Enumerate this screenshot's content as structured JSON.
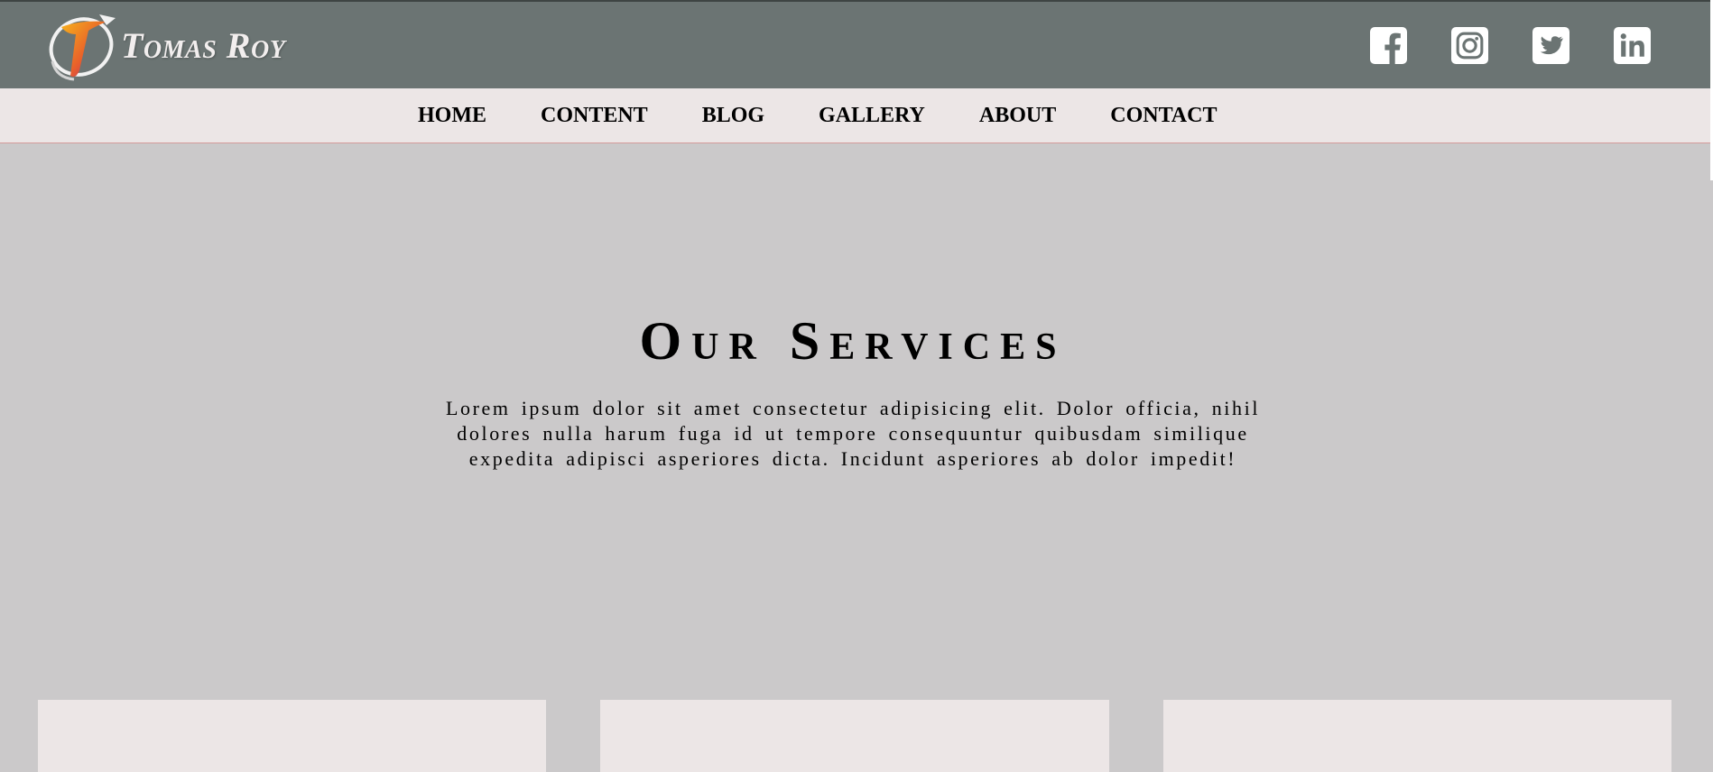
{
  "brand": {
    "name": "Tomas Roy",
    "logo_icon": "t-swoosh-logo-icon"
  },
  "social": [
    {
      "name": "facebook",
      "icon": "facebook-icon"
    },
    {
      "name": "instagram",
      "icon": "instagram-icon"
    },
    {
      "name": "twitter",
      "icon": "twitter-icon"
    },
    {
      "name": "linkedin",
      "icon": "linkedin-icon"
    }
  ],
  "nav": {
    "items": [
      "HOME",
      "CONTENT",
      "BLOG",
      "GALLERY",
      "ABOUT",
      "CONTACT"
    ]
  },
  "hero": {
    "title": "Our Services",
    "text": "Lorem ipsum dolor sit amet consectetur adipisicing elit. Dolor officia, nihil dolores nulla harum fuga id ut tempore consequuntur quibusdam similique expedita adipisci asperiores dicta. Incidunt asperiores ab dolor impedit!"
  },
  "colors": {
    "topbar": "#6b7473",
    "navbar": "#ece6e6",
    "page_bg": "#cbc9ca",
    "card_bg": "#ece6e6",
    "icon": "#ffffff"
  }
}
